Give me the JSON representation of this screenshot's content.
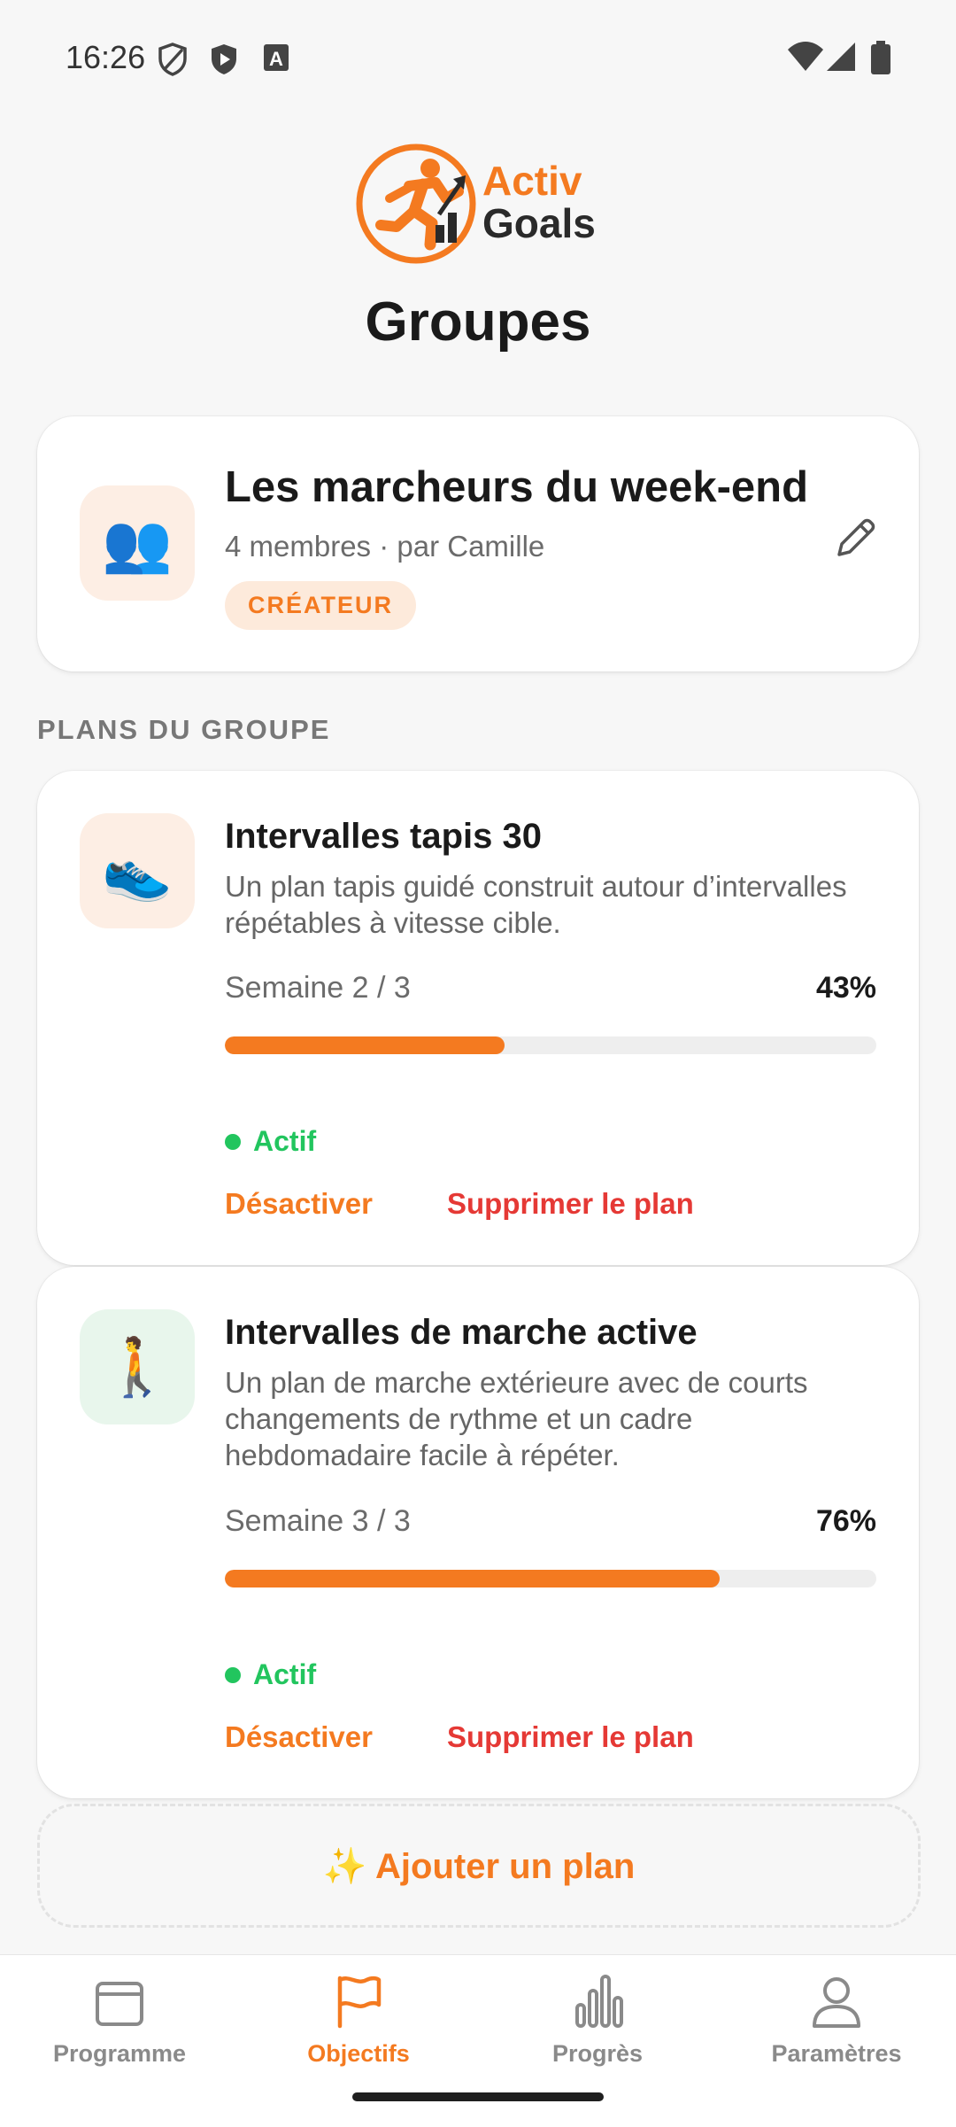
{
  "status_bar": {
    "time": "16:26"
  },
  "app": {
    "logo_line1": "Activ",
    "logo_line2": "Goals",
    "page_title": "Groupes"
  },
  "group": {
    "icon": "👥",
    "name": "Les marcheurs du week-end",
    "meta": "4 membres · par Camille",
    "badge": "CRÉATEUR"
  },
  "section": {
    "label": "PLANS DU GROUPE"
  },
  "plans": [
    {
      "icon": "👟",
      "title": "Intervalles tapis 30",
      "description": "Un plan tapis guidé construit autour d’intervalles répétables à vitesse cible.",
      "week": "Semaine 2 / 3",
      "percent": "43%",
      "progress": 0.43,
      "status": "Actif",
      "deactivate": "Désactiver",
      "delete": "Supprimer le plan"
    },
    {
      "icon": "🚶",
      "title": "Intervalles de marche active",
      "description": "Un plan de marche extérieure avec de courts changements de rythme et un cadre hebdomadaire facile à répéter.",
      "week": "Semaine 3 / 3",
      "percent": "76%",
      "progress": 0.76,
      "status": "Actif",
      "deactivate": "Désactiver",
      "delete": "Supprimer le plan"
    }
  ],
  "add_plan": {
    "label": "✨ Ajouter un plan"
  },
  "nav": {
    "items": [
      {
        "label": "Programme",
        "icon": "calendar-icon"
      },
      {
        "label": "Objectifs",
        "icon": "flag-icon"
      },
      {
        "label": "Progrès",
        "icon": "bar-chart-icon"
      },
      {
        "label": "Paramètres",
        "icon": "person-icon"
      }
    ],
    "active": 1
  },
  "colors": {
    "accent": "#f47a20",
    "active_status": "#22c55e",
    "danger": "#e53935"
  }
}
